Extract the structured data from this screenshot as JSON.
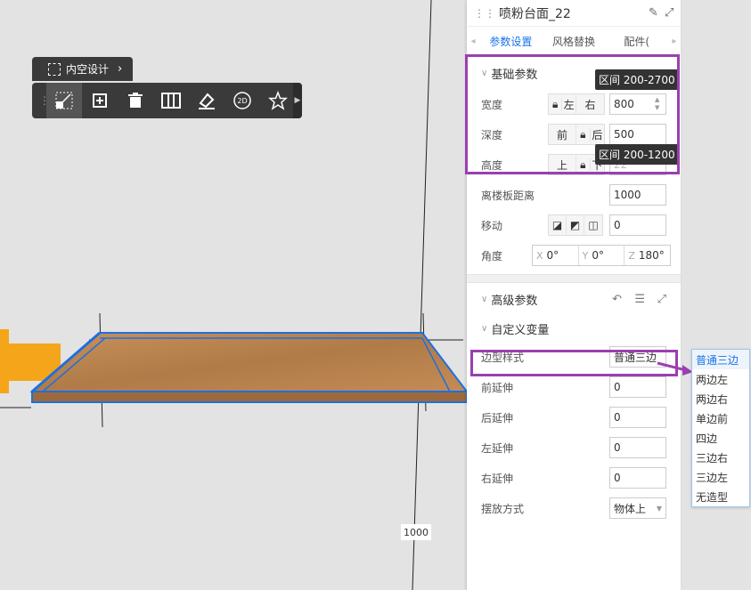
{
  "toolbar": {
    "title": "内空设计",
    "buttons": [
      {
        "name": "resize-tool",
        "icon": "resize-icon"
      },
      {
        "name": "add-copy",
        "icon": "add-copy-icon"
      },
      {
        "name": "delete",
        "icon": "trash-icon"
      },
      {
        "name": "split",
        "icon": "split-icon"
      },
      {
        "name": "brush",
        "icon": "brush-icon"
      },
      {
        "name": "view-2d",
        "icon": "2d-icon"
      },
      {
        "name": "favorite",
        "icon": "star-icon"
      }
    ]
  },
  "panel": {
    "title": "喷粉台面_22",
    "tabs": [
      "参数设置",
      "风格替换",
      "配件("
    ],
    "active_tab": 0,
    "basic": {
      "heading": "基础参数",
      "width": {
        "label": "宽度",
        "seg": [
          "左",
          "右"
        ],
        "value": "800",
        "tooltip": "区间 200-2700"
      },
      "depth": {
        "label": "深度",
        "seg": [
          "前",
          "后"
        ],
        "value": "500",
        "tooltip": "区间 200-1200"
      },
      "height": {
        "label": "高度",
        "seg": [
          "上",
          "下"
        ],
        "value": "22"
      },
      "floor_dist": {
        "label": "离楼板距离",
        "value": "1000"
      },
      "move": {
        "label": "移动",
        "value": "0"
      },
      "angle": {
        "label": "角度",
        "x": "0°",
        "y": "0°",
        "z": "180°",
        "x_axis": "X",
        "y_axis": "Y",
        "z_axis": "Z"
      }
    },
    "advanced": {
      "heading": "高级参数",
      "custom_heading": "自定义变量",
      "edge_style": {
        "label": "边型样式",
        "value": "普通三边"
      },
      "front_ext": {
        "label": "前延伸",
        "value": "0"
      },
      "back_ext": {
        "label": "后延伸",
        "value": "0"
      },
      "left_ext": {
        "label": "左延伸",
        "value": "0"
      },
      "right_ext": {
        "label": "右延伸",
        "value": "0"
      },
      "placement": {
        "label": "摆放方式",
        "value": "物体上"
      }
    }
  },
  "dropdown": {
    "options": [
      "普通三边",
      "两边左",
      "两边右",
      "单边前",
      "四边",
      "三边右",
      "三边左",
      "无造型"
    ],
    "selected": 0
  },
  "canvas": {
    "dimension_label": "1000"
  },
  "colors": {
    "highlight": "#9b3fb0",
    "accent": "#1a73e8",
    "selection": "#1e6fe0",
    "wood": "#b8804a"
  }
}
